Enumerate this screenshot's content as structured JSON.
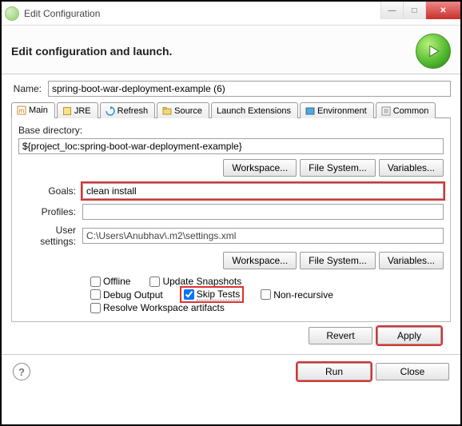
{
  "window": {
    "title": "Edit Configuration"
  },
  "banner": {
    "heading": "Edit configuration and launch."
  },
  "name": {
    "label": "Name:",
    "value": "spring-boot-war-deployment-example (6)"
  },
  "tabs": {
    "main": "Main",
    "jre": "JRE",
    "refresh": "Refresh",
    "source": "Source",
    "launchExt": "Launch Extensions",
    "environment": "Environment",
    "common": "Common"
  },
  "baseDir": {
    "label": "Base directory:",
    "value": "${project_loc:spring-boot-war-deployment-example}"
  },
  "goals": {
    "label": "Goals:",
    "value": "clean install"
  },
  "profiles": {
    "label": "Profiles:",
    "value": ""
  },
  "userSettings": {
    "label": "User settings:",
    "value": "C:\\Users\\Anubhav\\.m2\\settings.xml"
  },
  "buttons": {
    "workspace": "Workspace...",
    "filesystem": "File System...",
    "variables": "Variables...",
    "revert": "Revert",
    "apply": "Apply",
    "run": "Run",
    "close": "Close"
  },
  "checks": {
    "offline": "Offline",
    "updateSnapshots": "Update Snapshots",
    "debugOutput": "Debug Output",
    "skipTests": "Skip Tests",
    "nonRecursive": "Non-recursive",
    "resolveWs": "Resolve Workspace artifacts"
  }
}
